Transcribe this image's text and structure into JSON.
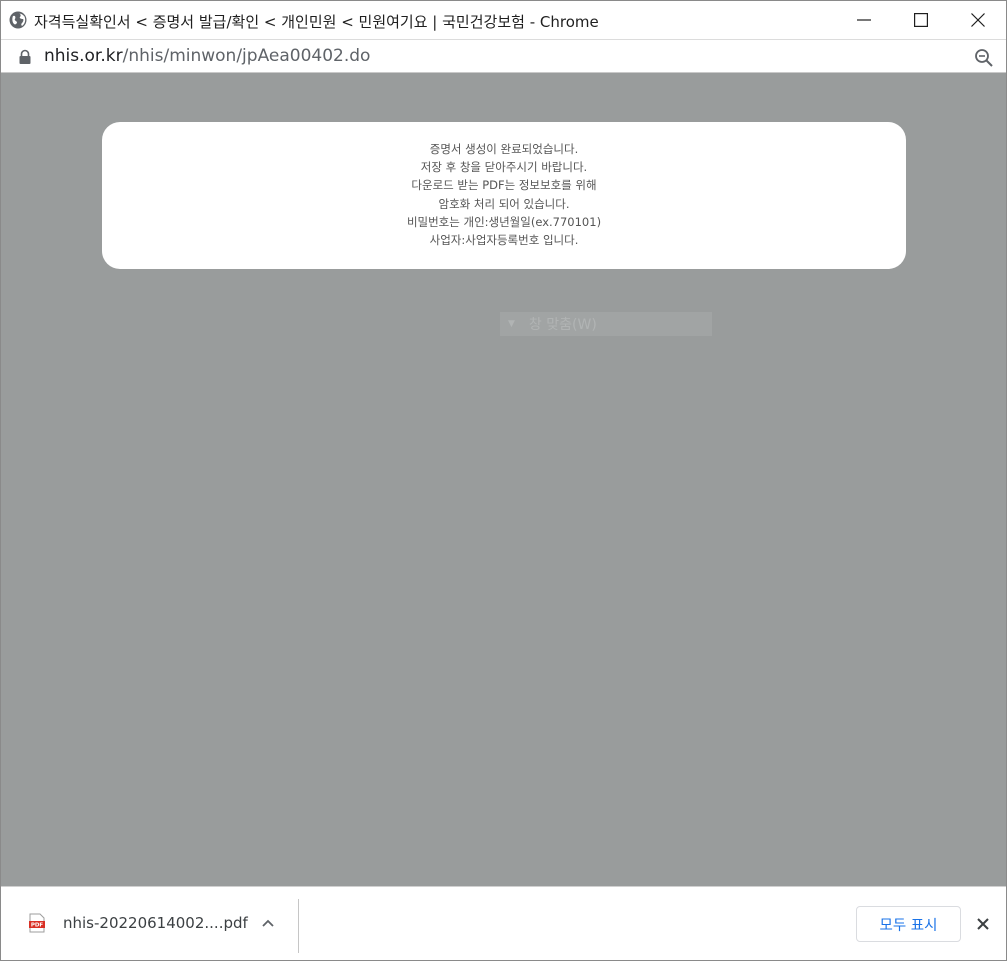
{
  "window": {
    "title": "자격득실확인서 < 증명서 발급/확인 < 개인민원 < 민원여기요 | 국민건강보험 - Chrome"
  },
  "addressbar": {
    "url_host": "nhis.or.kr",
    "url_path": "/nhis/minwon/jpAea00402.do"
  },
  "dialog": {
    "lines": [
      "증명서 생성이 완료되었습니다.",
      "저장 후 창을 닫아주시기 바랍니다.",
      "다운로드 받는 PDF는 정보보호를 위해",
      "암호화 처리 되어 있습니다.",
      "비밀번호는 개인:생년월일(ex.770101)",
      "사업자:사업자등록번호 입니다."
    ]
  },
  "background_control": {
    "label": "창 맞춤(W)"
  },
  "downloads": {
    "filename": "nhis-20220614002....pdf",
    "show_all_label": "모두 표시"
  },
  "icons": {
    "title": "globe-icon",
    "lock": "lock-icon",
    "zoom": "zoom-icon",
    "file": "pdf-file-icon",
    "chevron": "chevron-up-icon",
    "close": "close-icon"
  }
}
